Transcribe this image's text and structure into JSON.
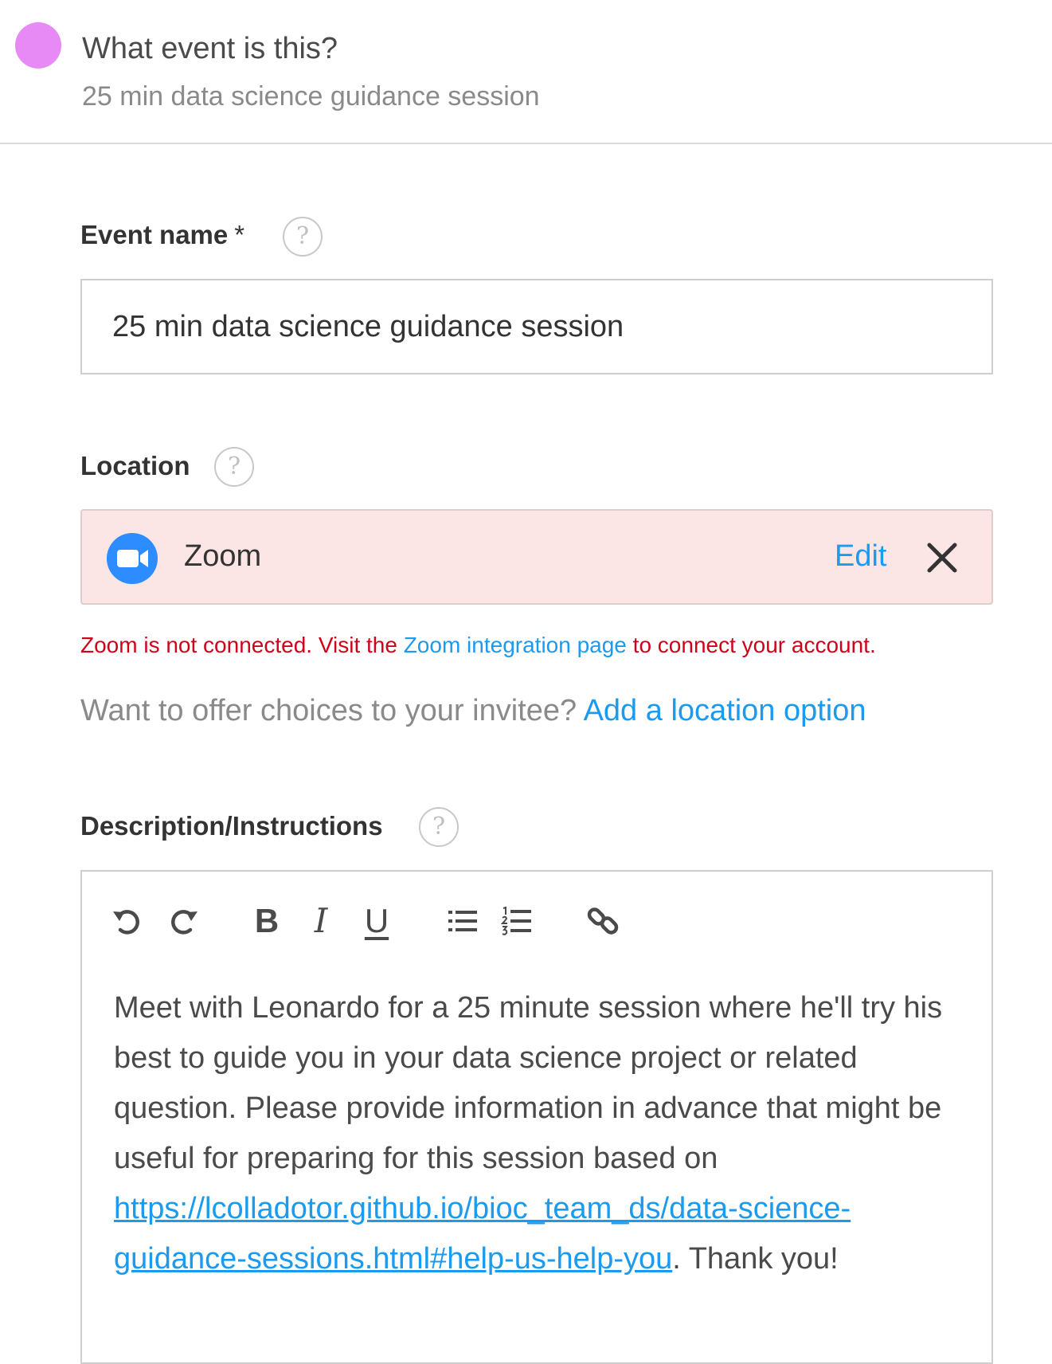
{
  "colors": {
    "event_dot": "#e88af5",
    "link": "#1a9bf0",
    "error": "#d0021b",
    "zoom_blue": "#2d8cff"
  },
  "header": {
    "title": "What event is this?",
    "subtitle": "25 min data science guidance session"
  },
  "event_name": {
    "label": "Event name",
    "required_mark": "*",
    "help_glyph": "?",
    "value": "25 min data science guidance session"
  },
  "location": {
    "label": "Location",
    "help_glyph": "?",
    "selected": {
      "name": "Zoom",
      "icon": "zoom-video-icon",
      "edit_label": "Edit",
      "remove_icon": "close-icon"
    },
    "error": {
      "prefix": "Zoom is not connected. Visit the ",
      "link_text": "Zoom integration page",
      "suffix": " to connect your account."
    },
    "choices": {
      "prompt": "Want to offer choices to your invitee? ",
      "link_text": "Add a location option"
    }
  },
  "description": {
    "label": "Description/Instructions",
    "help_glyph": "?",
    "toolbar": {
      "undo_icon": "undo-icon",
      "redo_icon": "redo-icon",
      "bold_label": "B",
      "italic_label": "I",
      "underline_label": "U",
      "bullet_list_icon": "bullet-list-icon",
      "numbered_list_icon": "numbered-list-icon",
      "link_icon": "link-icon"
    },
    "body": {
      "text_before": "Meet with Leonardo for a 25 minute session where he'll try his best to guide you in your data science project or related question. Please provide information in advance that might be useful for preparing for this session based on ",
      "url": "https://lcolladotor.github.io/bioc_team_ds/data-science-guidance-sessions.html#help-us-help-you",
      "text_after": ". Thank you!"
    }
  }
}
